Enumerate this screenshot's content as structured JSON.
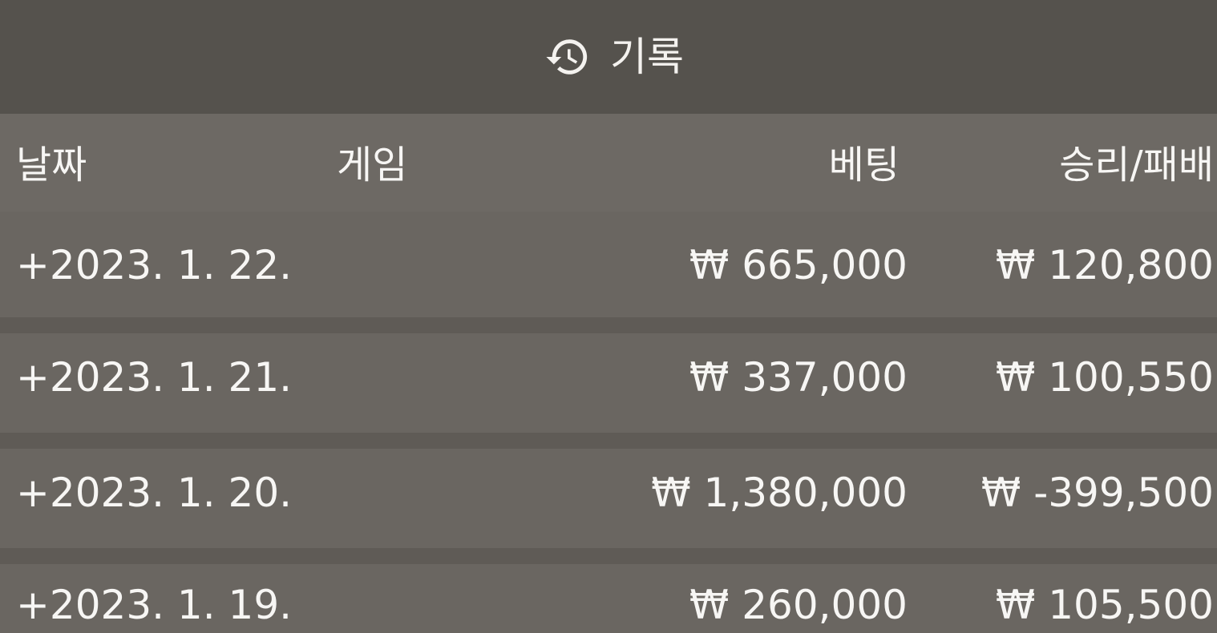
{
  "header": {
    "title": "기록",
    "icon": "history-icon"
  },
  "columns": {
    "date": "날짜",
    "game": "게임",
    "bet": "베팅",
    "result": "승리/패배"
  },
  "rows": [
    {
      "date": "+2023. 1. 22.",
      "game": "",
      "bet": "₩ 665,000",
      "result": "₩ 120,800"
    },
    {
      "date": "+2023. 1. 21.",
      "game": "",
      "bet": "₩ 337,000",
      "result": "₩ 100,550"
    },
    {
      "date": "+2023. 1. 20.",
      "game": "",
      "bet": "₩ 1,380,000",
      "result": "₩ -399,500"
    },
    {
      "date": "+2023. 1. 19.",
      "game": "",
      "bet": "₩ 260,000",
      "result": "₩ 105,500"
    }
  ]
}
